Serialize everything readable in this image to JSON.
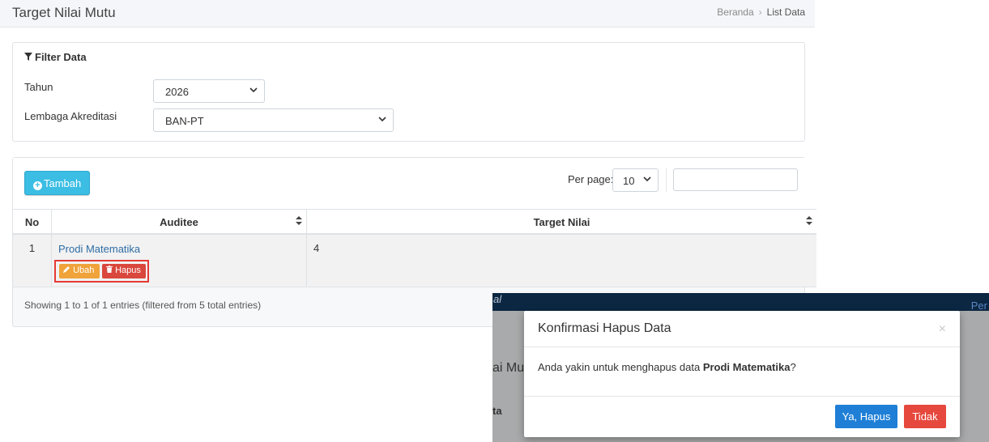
{
  "header": {
    "title": "Target Nilai Mutu",
    "breadcrumb": [
      "Beranda",
      "List Data"
    ],
    "separator": "›"
  },
  "filter": {
    "title": "Filter Data",
    "icon": "filter-icon",
    "tahun_label": "Tahun",
    "tahun_value": "2026",
    "lembaga_label": "Lembaga Akreditasi",
    "lembaga_value": "BAN-PT"
  },
  "toolbar": {
    "add_label": "Tambah",
    "per_page_label": "Per page:",
    "per_page_value": "10",
    "search_value": ""
  },
  "table": {
    "columns": [
      "No",
      "Auditee",
      "Target Nilai"
    ],
    "rows": [
      {
        "no": "1",
        "auditee": "Prodi Matematika",
        "target": "4",
        "edit_label": "Ubah",
        "delete_label": "Hapus"
      }
    ],
    "footer": "Showing 1 to 1 of 1 entries (filtered from 5 total entries)"
  },
  "overlay_bg": {
    "top_left": "al",
    "top_right": "Per",
    "text1": "ai Mu",
    "text2": "ta"
  },
  "modal": {
    "title": "Konfirmasi Hapus Data",
    "close": "×",
    "message_prefix": "Anda yakin untuk menghapus data ",
    "message_item": "Prodi Matematika",
    "message_suffix": "?",
    "confirm_label": "Ya, Hapus",
    "cancel_label": "Tidak"
  },
  "colors": {
    "info": "#3bbde4",
    "warning": "#f0a33a",
    "danger": "#d9473d",
    "primary": "#1f7fd6",
    "highlight": "#e53935",
    "navbar": "#0b2742"
  }
}
